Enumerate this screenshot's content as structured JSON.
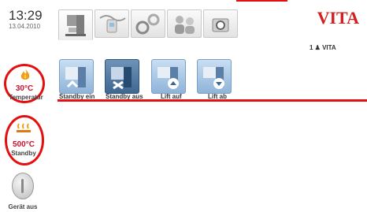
{
  "header": {
    "time": "13:29",
    "date": "13.04.2010",
    "brand": "VITA",
    "user_indicator": "1 ♟ VITA",
    "tabs": [
      "furnace",
      "firing",
      "settings",
      "users",
      "camera"
    ]
  },
  "actions": [
    {
      "label": "Standby ein"
    },
    {
      "label": "Standby aus"
    },
    {
      "label": "Lift auf"
    },
    {
      "label": "Lift ab"
    }
  ],
  "status": {
    "temperature_value": "30°C",
    "temperature_label": "Temperatur",
    "standby_value": "500°C",
    "standby_label": "Standby",
    "power_label": "Gerät aus"
  },
  "colors": {
    "accent_red": "#e41010",
    "brand_red": "#d21f1f",
    "button_blue": "#8fb4d9"
  }
}
